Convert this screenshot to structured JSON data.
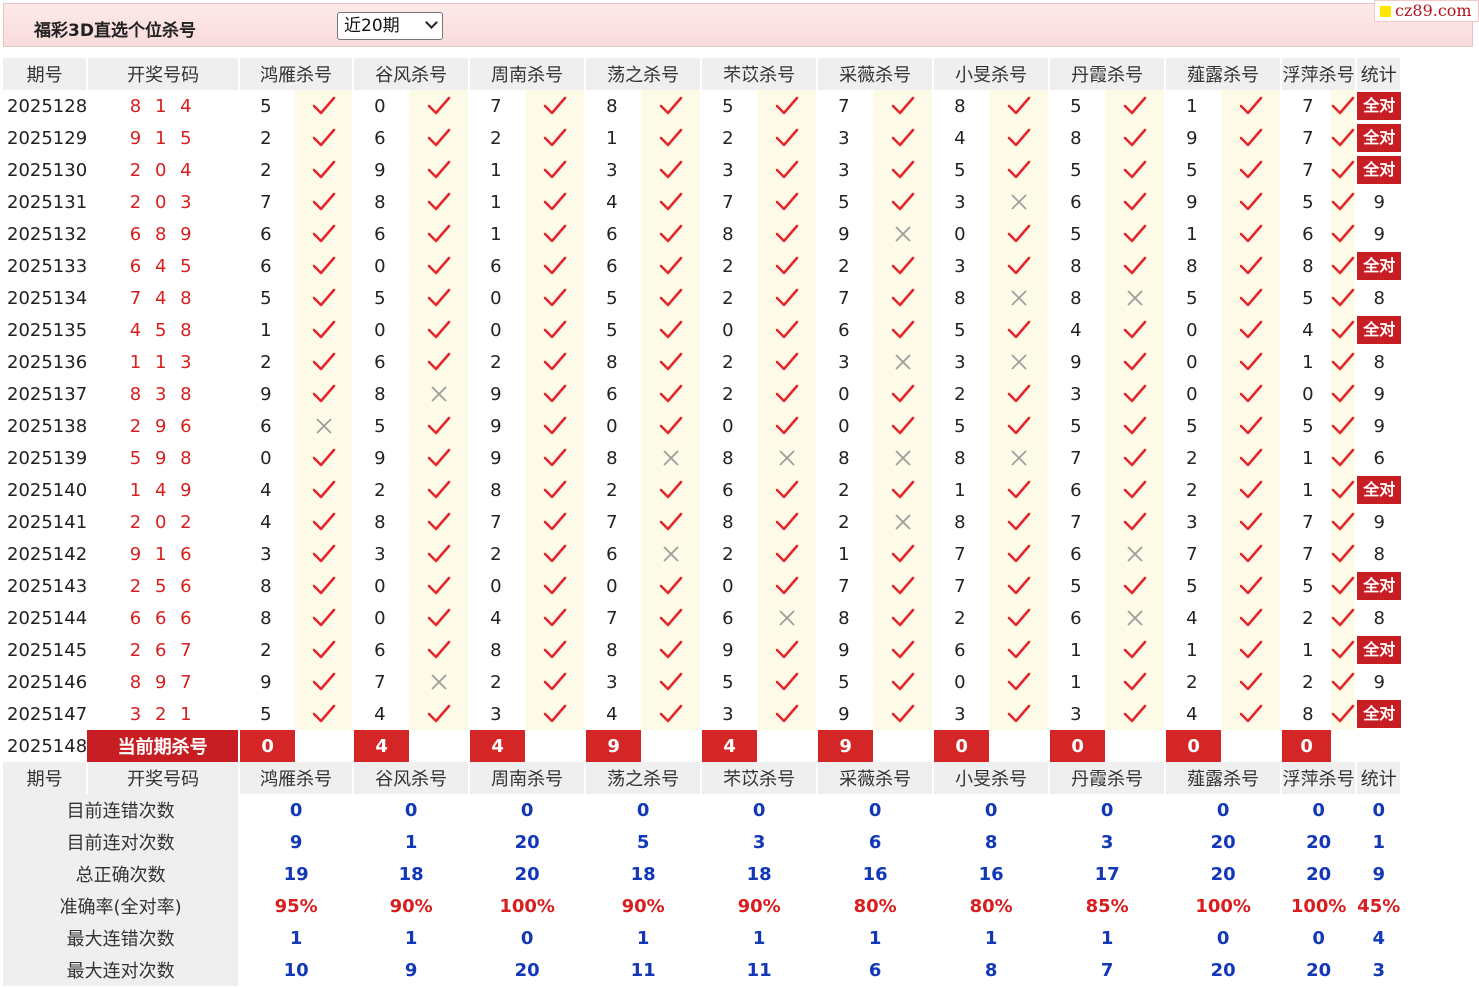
{
  "header": {
    "title": "福彩3D直选个位杀号",
    "select_value": "近20期",
    "brand": "cz89.com"
  },
  "columns": {
    "period": "期号",
    "numbers": "开奖号码",
    "experts": [
      "鸿雁杀号",
      "谷风杀号",
      "周南杀号",
      "荡之杀号",
      "芣苡杀号",
      "采薇杀号",
      "小旻杀号",
      "丹霞杀号",
      "薤露杀号",
      "浮萍杀号"
    ],
    "stat": "统计"
  },
  "labels": {
    "all_correct": "全对",
    "current_kill": "当前期杀号"
  },
  "rows": [
    {
      "period": "2025128",
      "numbers": "8 1 4",
      "kills": [
        5,
        0,
        7,
        8,
        5,
        7,
        8,
        5,
        1,
        7
      ],
      "hits": [
        1,
        1,
        1,
        1,
        1,
        1,
        1,
        1,
        1,
        1
      ],
      "stat": "全对"
    },
    {
      "period": "2025129",
      "numbers": "9 1 5",
      "kills": [
        2,
        6,
        2,
        1,
        2,
        3,
        4,
        8,
        9,
        7
      ],
      "hits": [
        1,
        1,
        1,
        1,
        1,
        1,
        1,
        1,
        1,
        1
      ],
      "stat": "全对"
    },
    {
      "period": "2025130",
      "numbers": "2 0 4",
      "kills": [
        2,
        9,
        1,
        3,
        3,
        3,
        5,
        5,
        5,
        7
      ],
      "hits": [
        1,
        1,
        1,
        1,
        1,
        1,
        1,
        1,
        1,
        1
      ],
      "stat": "全对"
    },
    {
      "period": "2025131",
      "numbers": "2 0 3",
      "kills": [
        7,
        8,
        1,
        4,
        7,
        5,
        3,
        6,
        9,
        5
      ],
      "hits": [
        1,
        1,
        1,
        1,
        1,
        1,
        0,
        1,
        1,
        1
      ],
      "stat": "9"
    },
    {
      "period": "2025132",
      "numbers": "6 8 9",
      "kills": [
        6,
        6,
        1,
        6,
        8,
        9,
        0,
        5,
        1,
        6
      ],
      "hits": [
        1,
        1,
        1,
        1,
        1,
        0,
        1,
        1,
        1,
        1
      ],
      "stat": "9"
    },
    {
      "period": "2025133",
      "numbers": "6 4 5",
      "kills": [
        6,
        0,
        6,
        6,
        2,
        2,
        3,
        8,
        8,
        8
      ],
      "hits": [
        1,
        1,
        1,
        1,
        1,
        1,
        1,
        1,
        1,
        1
      ],
      "stat": "全对"
    },
    {
      "period": "2025134",
      "numbers": "7 4 8",
      "kills": [
        5,
        5,
        0,
        5,
        2,
        7,
        8,
        8,
        5,
        5
      ],
      "hits": [
        1,
        1,
        1,
        1,
        1,
        1,
        0,
        0,
        1,
        1
      ],
      "stat": "8"
    },
    {
      "period": "2025135",
      "numbers": "4 5 8",
      "kills": [
        1,
        0,
        0,
        5,
        0,
        6,
        5,
        4,
        0,
        4
      ],
      "hits": [
        1,
        1,
        1,
        1,
        1,
        1,
        1,
        1,
        1,
        1
      ],
      "stat": "全对"
    },
    {
      "period": "2025136",
      "numbers": "1 1 3",
      "kills": [
        2,
        6,
        2,
        8,
        2,
        3,
        3,
        9,
        0,
        1
      ],
      "hits": [
        1,
        1,
        1,
        1,
        1,
        0,
        0,
        1,
        1,
        1
      ],
      "stat": "8"
    },
    {
      "period": "2025137",
      "numbers": "8 3 8",
      "kills": [
        9,
        8,
        9,
        6,
        2,
        0,
        2,
        3,
        0,
        0
      ],
      "hits": [
        1,
        0,
        1,
        1,
        1,
        1,
        1,
        1,
        1,
        1
      ],
      "stat": "9"
    },
    {
      "period": "2025138",
      "numbers": "2 9 6",
      "kills": [
        6,
        5,
        9,
        0,
        0,
        0,
        5,
        5,
        5,
        5
      ],
      "hits": [
        0,
        1,
        1,
        1,
        1,
        1,
        1,
        1,
        1,
        1
      ],
      "stat": "9"
    },
    {
      "period": "2025139",
      "numbers": "5 9 8",
      "kills": [
        0,
        9,
        9,
        8,
        8,
        8,
        8,
        7,
        2,
        1
      ],
      "hits": [
        1,
        1,
        1,
        0,
        0,
        0,
        0,
        1,
        1,
        1
      ],
      "stat": "6"
    },
    {
      "period": "2025140",
      "numbers": "1 4 9",
      "kills": [
        4,
        2,
        8,
        2,
        6,
        2,
        1,
        6,
        2,
        1
      ],
      "hits": [
        1,
        1,
        1,
        1,
        1,
        1,
        1,
        1,
        1,
        1
      ],
      "stat": "全对"
    },
    {
      "period": "2025141",
      "numbers": "2 0 2",
      "kills": [
        4,
        8,
        7,
        7,
        8,
        2,
        8,
        7,
        3,
        7
      ],
      "hits": [
        1,
        1,
        1,
        1,
        1,
        0,
        1,
        1,
        1,
        1
      ],
      "stat": "9"
    },
    {
      "period": "2025142",
      "numbers": "9 1 6",
      "kills": [
        3,
        3,
        2,
        6,
        2,
        1,
        7,
        6,
        7,
        7
      ],
      "hits": [
        1,
        1,
        1,
        0,
        1,
        1,
        1,
        0,
        1,
        1
      ],
      "stat": "8"
    },
    {
      "period": "2025143",
      "numbers": "2 5 6",
      "kills": [
        8,
        0,
        0,
        0,
        0,
        7,
        7,
        5,
        5,
        5
      ],
      "hits": [
        1,
        1,
        1,
        1,
        1,
        1,
        1,
        1,
        1,
        1
      ],
      "stat": "全对"
    },
    {
      "period": "2025144",
      "numbers": "6 6 6",
      "kills": [
        8,
        0,
        4,
        7,
        6,
        8,
        2,
        6,
        4,
        2
      ],
      "hits": [
        1,
        1,
        1,
        1,
        0,
        1,
        1,
        0,
        1,
        1
      ],
      "stat": "8"
    },
    {
      "period": "2025145",
      "numbers": "2 6 7",
      "kills": [
        2,
        6,
        8,
        8,
        9,
        9,
        6,
        1,
        1,
        1
      ],
      "hits": [
        1,
        1,
        1,
        1,
        1,
        1,
        1,
        1,
        1,
        1
      ],
      "stat": "全对"
    },
    {
      "period": "2025146",
      "numbers": "8 9 7",
      "kills": [
        9,
        7,
        2,
        3,
        5,
        5,
        0,
        1,
        2,
        2
      ],
      "hits": [
        1,
        0,
        1,
        1,
        1,
        1,
        1,
        1,
        1,
        1
      ],
      "stat": "9"
    },
    {
      "period": "2025147",
      "numbers": "3 2 1",
      "kills": [
        5,
        4,
        3,
        4,
        3,
        9,
        3,
        3,
        4,
        8
      ],
      "hits": [
        1,
        1,
        1,
        1,
        1,
        1,
        1,
        1,
        1,
        1
      ],
      "stat": "全对"
    }
  ],
  "current": {
    "period": "2025148",
    "kills": [
      "0",
      "4",
      "4",
      "9",
      "4",
      "9",
      "0",
      "0",
      "0",
      "0"
    ]
  },
  "summary": [
    {
      "label": "目前连错次数",
      "values": [
        "0",
        "0",
        "0",
        "0",
        "0",
        "0",
        "0",
        "0",
        "0",
        "0"
      ],
      "stat": "0"
    },
    {
      "label": "目前连对次数",
      "values": [
        "9",
        "1",
        "20",
        "5",
        "3",
        "6",
        "8",
        "3",
        "20",
        "20"
      ],
      "stat": "1"
    },
    {
      "label": "总正确次数",
      "values": [
        "19",
        "18",
        "20",
        "18",
        "18",
        "16",
        "16",
        "17",
        "20",
        "20"
      ],
      "stat": "9"
    },
    {
      "label": "准确率(全对率)",
      "values": [
        "95%",
        "90%",
        "100%",
        "90%",
        "90%",
        "80%",
        "80%",
        "85%",
        "100%",
        "100%"
      ],
      "stat": "45%"
    },
    {
      "label": "最大连错次数",
      "values": [
        "1",
        "1",
        "0",
        "1",
        "1",
        "1",
        "1",
        "1",
        "0",
        "0"
      ],
      "stat": "4"
    },
    {
      "label": "最大连对次数",
      "values": [
        "10",
        "9",
        "20",
        "11",
        "11",
        "6",
        "8",
        "7",
        "20",
        "20"
      ],
      "stat": "3"
    }
  ],
  "icons": {
    "hit": "check-icon",
    "miss": "cross-icon"
  },
  "colors": {
    "accent_red": "#c71e23",
    "number_red": "#d81e1e",
    "summary_blue": "#1238b8"
  }
}
